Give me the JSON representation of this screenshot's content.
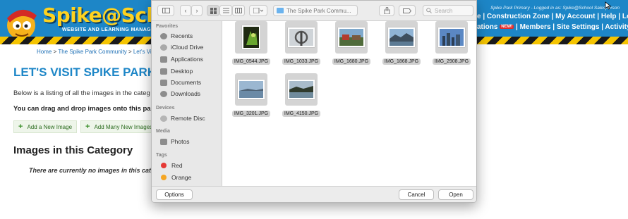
{
  "site": {
    "logo_text": "Spike@School",
    "logo_sub": "WEBSITE AND LEARNING MANAGEMENT",
    "login_note": "Spike Park Primary - Logged in as: Spike@School Salesperson",
    "nav_row1": [
      "e",
      "Construction Zone",
      "My Account",
      "Help",
      "Logout"
    ],
    "nav_row2_prefix": "ations",
    "nav_new_badge": "NEW!",
    "nav_row2": [
      "Members",
      "Site Settings",
      "Activity Logs"
    ],
    "colors": {
      "header": "#1d86c7",
      "logo": "#ffd21f",
      "hazard_yellow": "#f5c400",
      "title_blue": "#1d86c7"
    }
  },
  "breadcrumb": [
    "Home",
    "The Spike Park Community",
    "Let's Vis"
  ],
  "page": {
    "title": "LET'S VISIT SPIKE PARK",
    "desc1": "Below is a listing of all the images in the categ",
    "desc2": "You can drag and drop images onto this pag",
    "add_button": "Add a New Image",
    "add_many_button": "Add Many New Images",
    "section_heading": "Images in this Category",
    "empty_note": "There are currently no images in this categ"
  },
  "dialog": {
    "location": "The Spike Park Commu...",
    "search_placeholder": "Search",
    "sidebar": {
      "favorites_head": "Favorites",
      "favorites": [
        {
          "label": "Recents",
          "icon": "clock-icon"
        },
        {
          "label": "iCloud Drive",
          "icon": "cloud-icon"
        },
        {
          "label": "Applications",
          "icon": "applications-icon"
        },
        {
          "label": "Desktop",
          "icon": "desktop-icon"
        },
        {
          "label": "Documents",
          "icon": "document-icon"
        },
        {
          "label": "Downloads",
          "icon": "download-icon"
        }
      ],
      "devices_head": "Devices",
      "devices": [
        {
          "label": "Remote Disc",
          "icon": "disc-icon"
        }
      ],
      "media_head": "Media",
      "media": [
        {
          "label": "Photos",
          "icon": "camera-icon"
        }
      ],
      "tags_head": "Tags",
      "tags": [
        {
          "label": "Red",
          "color": "#e53935"
        },
        {
          "label": "Orange",
          "color": "#f5a623"
        }
      ]
    },
    "files": [
      "IMG_0544.JPG",
      "IMG_1033.JPG",
      "IMG_1680.JPG",
      "IMG_1868.JPG",
      "IMG_2908.JPG",
      "IMG_3201.JPG",
      "IMG_4150.JPG"
    ],
    "options_button": "Options",
    "cancel_button": "Cancel",
    "open_button": "Open"
  }
}
